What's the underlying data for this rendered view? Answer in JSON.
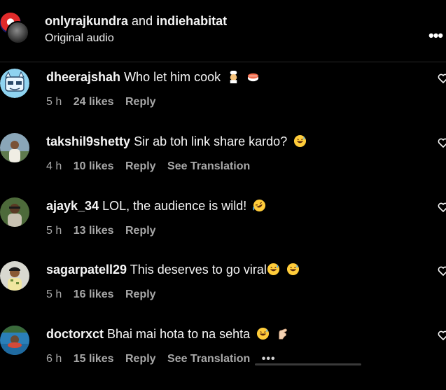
{
  "header": {
    "user1": "onlyrajkundra",
    "and_text": "and",
    "user2": "indiehabitat",
    "subtitle": "Original audio"
  },
  "comments": [
    {
      "username": "dheerajshah",
      "text": "Who let him cook",
      "emojis": [
        "cook-emoji",
        "sushi-emoji"
      ],
      "time": "5 h",
      "likes": "24 likes",
      "reply": "Reply",
      "translate": ""
    },
    {
      "username": "takshil9shetty",
      "text": "Sir ab toh link share kardo?",
      "emojis": [
        "grinning-sweat-emoji"
      ],
      "time": "4 h",
      "likes": "10 likes",
      "reply": "Reply",
      "translate": "See Translation"
    },
    {
      "username": "ajayk_34",
      "text": "LOL, the audience is wild!",
      "emojis": [
        "rofl-emoji"
      ],
      "time": "5 h",
      "likes": "13 likes",
      "reply": "Reply",
      "translate": ""
    },
    {
      "username": "sagarpatell29",
      "text": "This deserves to go viral",
      "emojis": [
        "grinning-sweat-emoji",
        "grinning-sweat-emoji"
      ],
      "time": "5 h",
      "likes": "16 likes",
      "reply": "Reply",
      "translate": ""
    },
    {
      "username": "doctorxct",
      "text": "Bhai mai hota to na sehta",
      "emojis": [
        "grinning-sweat-emoji",
        "pinch-hand-emoji"
      ],
      "time": "6 h",
      "likes": "15 likes",
      "reply": "Reply",
      "translate": "See Translation"
    }
  ]
}
